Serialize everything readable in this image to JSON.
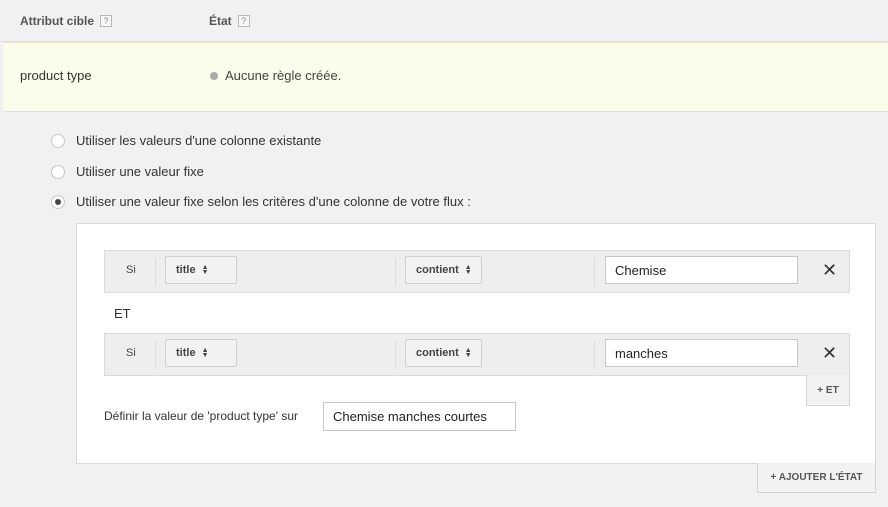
{
  "header": {
    "target_attribute": "Attribut cible",
    "state": "État",
    "help_glyph": "?"
  },
  "row": {
    "attribute": "product type",
    "status": "Aucune règle créée."
  },
  "options": [
    {
      "label": "Utiliser les valeurs d'une colonne existante",
      "checked": false
    },
    {
      "label": "Utiliser une valeur fixe",
      "checked": false
    },
    {
      "label": "Utiliser une valeur fixe selon les critères d'une colonne de votre flux :",
      "checked": true
    }
  ],
  "conditions": [
    {
      "if_label": "Si",
      "column": "title",
      "operator": "contient",
      "value": "Chemise"
    },
    {
      "if_label": "Si",
      "column": "title",
      "operator": "contient",
      "value": "manches"
    }
  ],
  "and_label": "ET",
  "add_and_button": "+ ET",
  "define_label": "Définir la valeur de 'product type' sur",
  "define_value": "Chemise manches courtes",
  "add_state_button": "+ AJOUTER L'ÉTAT",
  "icons": {
    "remove": "close-icon",
    "sort": "sort-arrows-icon",
    "status": "gray-dot-icon"
  }
}
